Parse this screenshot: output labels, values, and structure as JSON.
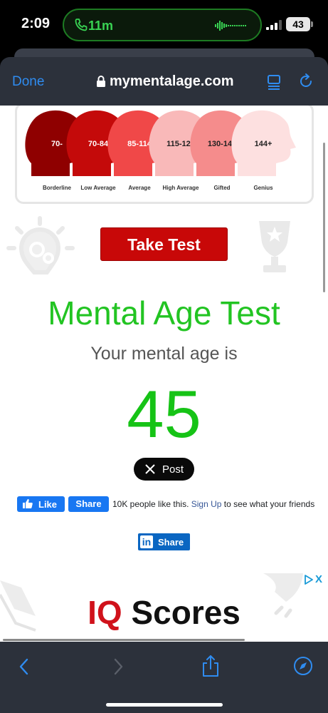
{
  "status_bar": {
    "time": "2:09",
    "call_duration": "11m",
    "battery": "43"
  },
  "browser": {
    "done_label": "Done",
    "url": "mymentalage.com"
  },
  "iq_chart": {
    "ranges": [
      {
        "range": "70-",
        "label": "Borderline",
        "color": "#8f0000"
      },
      {
        "range": "70-84",
        "label": "Low Average",
        "color": "#c40a0a"
      },
      {
        "range": "85-114",
        "label": "Average",
        "color": "#f04848"
      },
      {
        "range": "115-129",
        "label": "High Average",
        "color": "#f9b9b9"
      },
      {
        "range": "130-144",
        "label": "Gifted",
        "color": "#f58c8c"
      },
      {
        "range": "144+",
        "label": "Genius",
        "color": "#fde0e0"
      }
    ]
  },
  "main": {
    "take_test_label": "Take Test",
    "title": "Mental Age Test",
    "subtitle": "Your mental age is",
    "age": "45"
  },
  "social": {
    "x_post_label": "Post",
    "fb_like_label": "Like",
    "fb_share_label": "Share",
    "fb_count_text": "10K people like this.",
    "fb_signup_label": "Sign Up",
    "fb_rest_text": "to see what your friends",
    "linkedin_share_label": "Share"
  },
  "ad": {
    "title_prefix": "IQ",
    "title_rest": "Scores",
    "close_label": "X"
  },
  "colors": {
    "accent_green": "#16c316",
    "brand_red": "#c80808",
    "ios_blue": "#2f8cf0",
    "facebook_blue": "#1877f2",
    "linkedin_blue": "#0a66c2"
  },
  "icons": [
    "phone-icon",
    "waveform-icon",
    "signal-icon",
    "battery-icon",
    "lock-icon",
    "reader-icon",
    "reload-icon",
    "lightbulb-icon",
    "trophy-icon",
    "x-logo-icon",
    "thumbs-up-icon",
    "linkedin-icon",
    "book-icon",
    "rocket-icon",
    "adchoices-icon",
    "back-icon",
    "forward-icon",
    "share-icon",
    "compass-icon"
  ]
}
